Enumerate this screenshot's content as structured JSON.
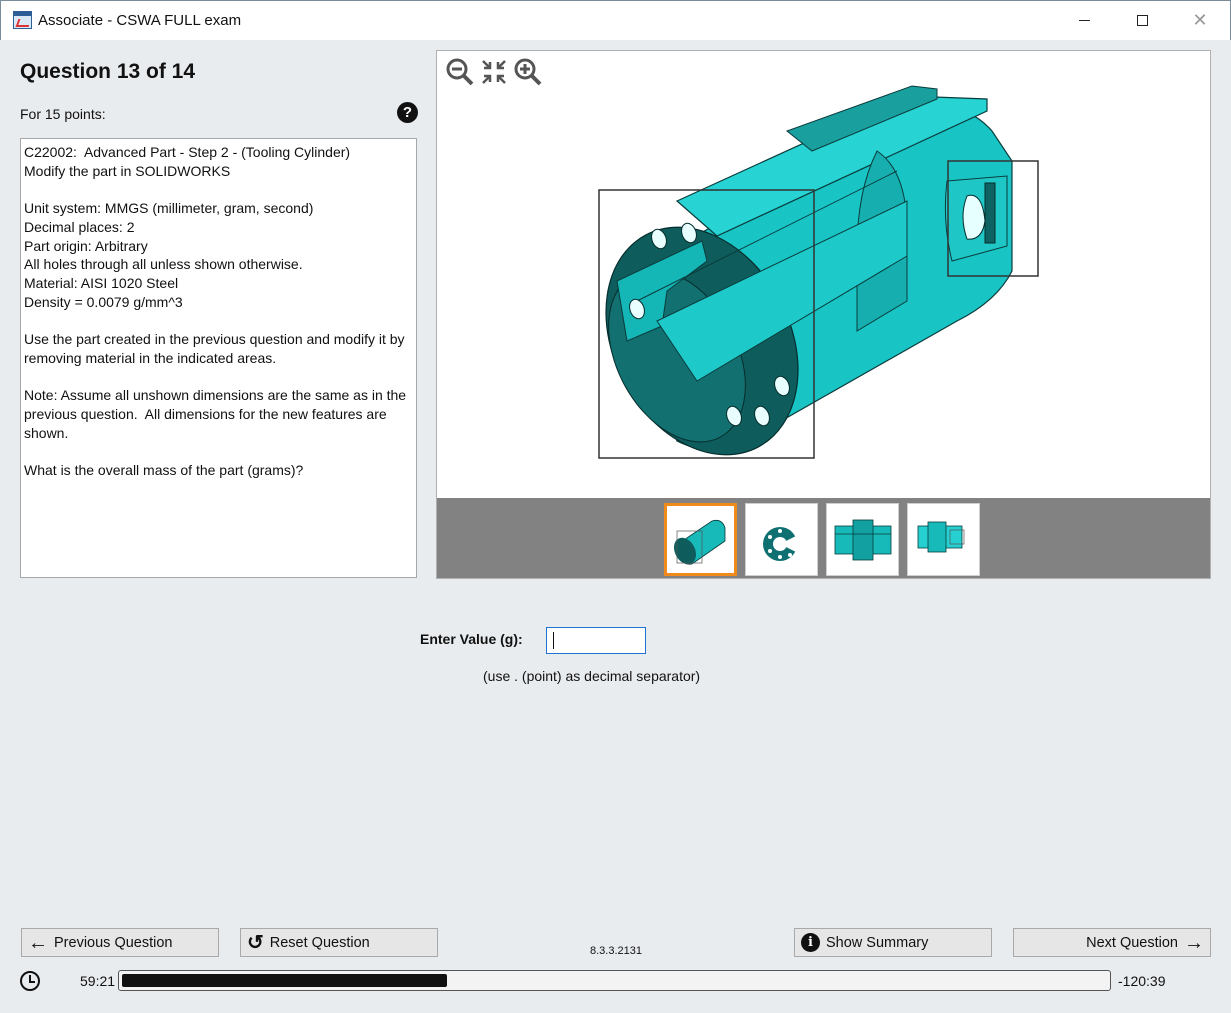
{
  "window": {
    "title": "Associate - CSWA FULL exam",
    "min_glyph": "",
    "close_glyph": "✕"
  },
  "question": {
    "title": "Question 13 of 14",
    "points": "For 15 points:",
    "help_glyph": "?",
    "text": "C22002:  Advanced Part - Step 2 - (Tooling Cylinder)\nModify the part in SOLIDWORKS\n\nUnit system: MMGS (millimeter, gram, second)\nDecimal places: 2\nPart origin: Arbitrary\nAll holes through all unless shown otherwise.\nMaterial: AISI 1020 Steel\nDensity = 0.0079 g/mm^3\n\nUse the part created in the previous question and modify it by removing material in the indicated areas.\n\nNote: Assume all unshown dimensions are the same as in the previous question.  All dimensions for the new features are shown.\n\nWhat is the overall mass of the part (grams)?"
  },
  "viewer": {
    "zoom_tools": [
      "zoom-out-icon",
      "fit-icon",
      "zoom-in-icon"
    ],
    "thumbnails": 4,
    "selected_thumbnail": 1,
    "part_color": "#1fbdbd"
  },
  "answer": {
    "label": "Enter Value (g):",
    "value": "",
    "hint": "(use . (point) as decimal separator)"
  },
  "nav": {
    "prev_label": "Previous Question",
    "reset_label": "Reset Question",
    "summary_label": "Show Summary",
    "next_label": "Next Question",
    "prev_icon": "←",
    "reset_icon": "↺",
    "summary_icon": "i",
    "next_icon": "→"
  },
  "footer": {
    "version": "8.3.3.2131",
    "elapsed": "59:21",
    "remaining": "-120:39",
    "progress_fraction": 0.33
  }
}
